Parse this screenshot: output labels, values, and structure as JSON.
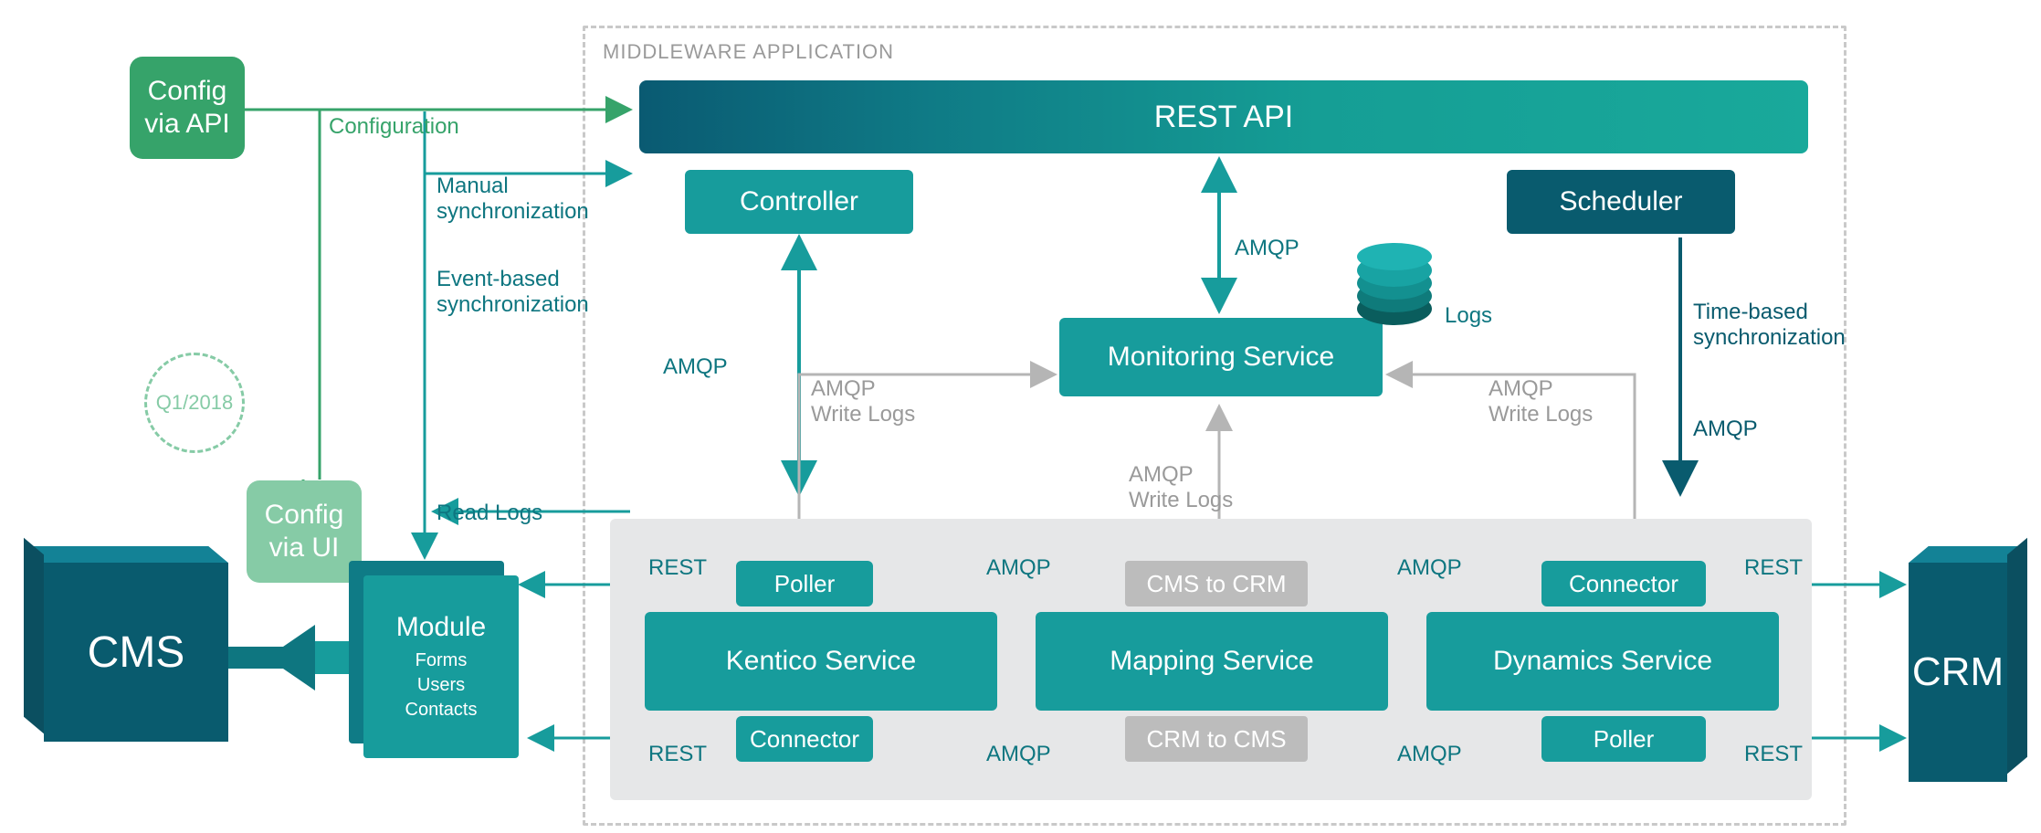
{
  "containerTitle": "MIDDLEWARE APPLICATION",
  "left": {
    "cms": "CMS",
    "module": {
      "title": "Module",
      "sub1": "Forms",
      "sub2": "Users",
      "sub3": "Contacts"
    },
    "configApi": "Config\nvia API",
    "configUi": "Config\nvia UI",
    "q1": "Q1/2018",
    "configuration": "Configuration",
    "manualSync": "Manual\nsynchronization",
    "eventSync": "Event-based\nsynchronization",
    "readLogs": "Read Logs"
  },
  "right": {
    "crm": "CRM"
  },
  "top": {
    "restApi": "REST API",
    "controller": "Controller",
    "scheduler": "Scheduler",
    "timeSync": "Time-based\nsynchronization",
    "amqp": "AMQP"
  },
  "middle": {
    "monitoring": "Monitoring Service",
    "logs": "Logs",
    "amqp": "AMQP",
    "writeLogsL": "AMQP\nWrite Logs",
    "writeLogsR": "AMQP\nWrite Logs",
    "writeLogsC": "AMQP\nWrite Logs"
  },
  "services": {
    "kentico": "Kentico Service",
    "mapping": "Mapping Service",
    "dynamics": "Dynamics Service",
    "poller": "Poller",
    "connector": "Connector",
    "cmsToCrm": "CMS to CRM",
    "crmToCms": "CRM to CMS"
  },
  "flow": {
    "rest": "REST",
    "amqp": "AMQP"
  }
}
